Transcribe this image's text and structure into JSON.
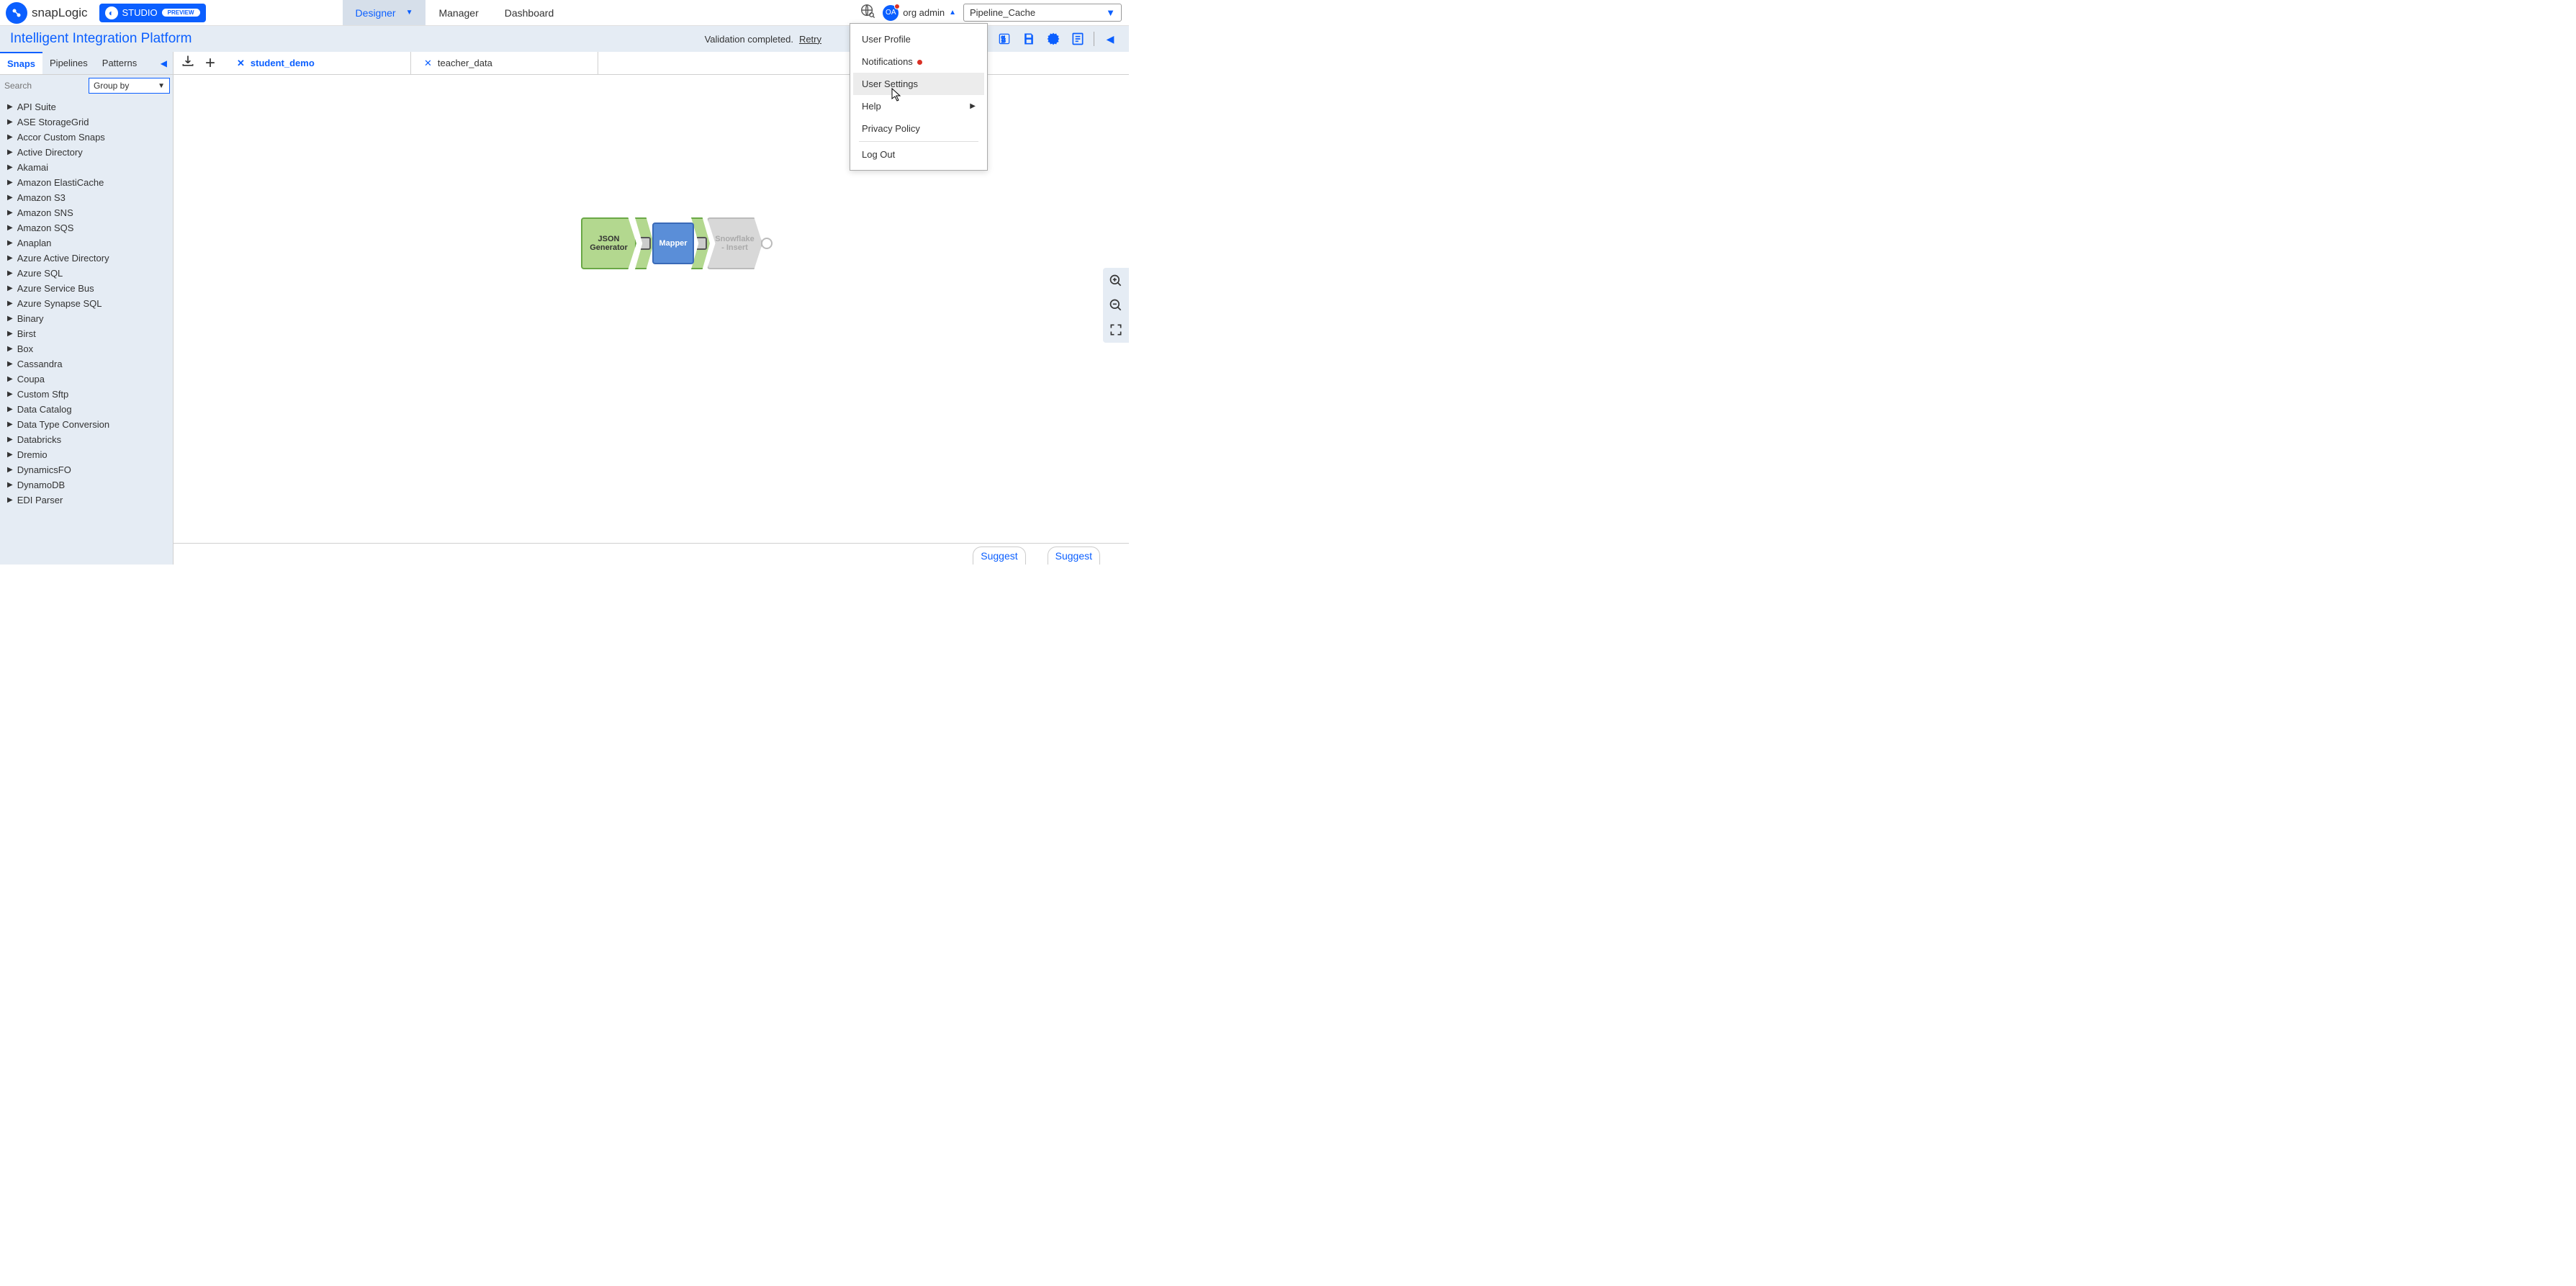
{
  "brand": {
    "name": "snapLogic",
    "studio": "STUDIO",
    "preview": "PREVIEW"
  },
  "nav": {
    "designer": "Designer",
    "manager": "Manager",
    "dashboard": "Dashboard"
  },
  "user": {
    "initials": "OA",
    "name": "org admin",
    "pipeline_selector": "Pipeline_Cache"
  },
  "subheader": {
    "title": "Intelligent Integration Platform",
    "validation_status": "Validation completed.",
    "retry": "Retry"
  },
  "palette": {
    "tabs": {
      "snaps": "Snaps",
      "pipelines": "Pipelines",
      "patterns": "Patterns"
    },
    "search_placeholder": "Search",
    "group_by": "Group by",
    "items": [
      "API Suite",
      "ASE StorageGrid",
      "Accor Custom Snaps",
      "Active Directory",
      "Akamai",
      "Amazon ElastiCache",
      "Amazon S3",
      "Amazon SNS",
      "Amazon SQS",
      "Anaplan",
      "Azure Active Directory",
      "Azure SQL",
      "Azure Service Bus",
      "Azure Synapse SQL",
      "Binary",
      "Birst",
      "Box",
      "Cassandra",
      "Coupa",
      "Custom Sftp",
      "Data Catalog",
      "Data Type Conversion",
      "Databricks",
      "Dremio",
      "DynamicsFO",
      "DynamoDB",
      "EDI Parser"
    ]
  },
  "canvas": {
    "tabs": [
      {
        "label": "student_demo",
        "active": true
      },
      {
        "label": "teacher_data",
        "active": false
      }
    ],
    "nodes": {
      "json_generator": "JSON Generator",
      "mapper": "Mapper",
      "snowflake_insert": "Snowflake - Insert"
    }
  },
  "user_menu": {
    "profile": "User Profile",
    "notifications": "Notifications",
    "settings": "User Settings",
    "help": "Help",
    "privacy": "Privacy Policy",
    "logout": "Log Out"
  },
  "footer": {
    "suggest1": "Suggest",
    "suggest2": "Suggest"
  }
}
